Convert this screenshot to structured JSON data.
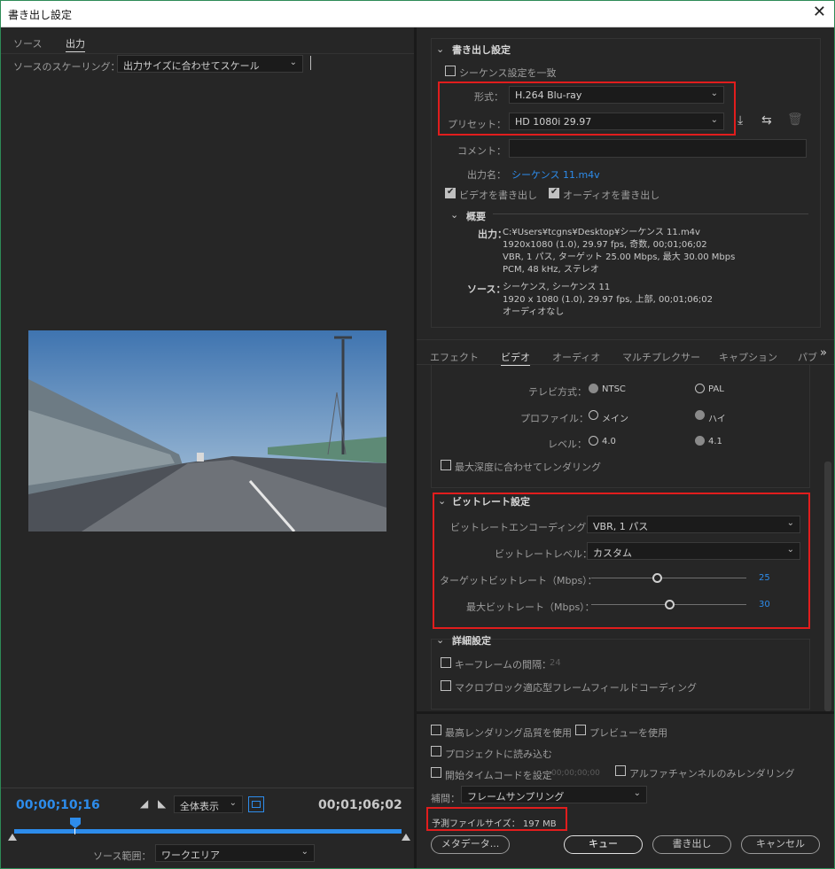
{
  "window": {
    "title": "書き出し設定",
    "close_icon": "close-icon"
  },
  "left": {
    "tabs": [
      "ソース",
      "出力"
    ],
    "scaling_label": "ソースのスケーリング：",
    "scaling_value": "出力サイズに合わせてスケール",
    "timecode_current": "00;00;10;16",
    "timecode_end": "00;01;06;02",
    "zoom_value": "全体表示",
    "source_range_label": "ソース範囲：",
    "source_range_value": "ワークエリア"
  },
  "export": {
    "header": "書き出し設定",
    "match_sequence": "シーケンス設定を一致",
    "format_label": "形式：",
    "format_value": "H.264 Blu-ray",
    "preset_label": "プリセット：",
    "preset_value": "HD 1080i 29.97",
    "comment_label": "コメント：",
    "output_name_label": "出力名：",
    "output_name_value": "シーケンス 11.m4v",
    "export_video": "ビデオを書き出し",
    "export_audio": "オーディオを書き出し",
    "summary_header": "概要",
    "summary_output_label": "出力：",
    "summary_output_lines": [
      "C:¥Users¥tcgns¥Desktop¥シーケンス 11.m4v",
      "1920x1080 (1.0), 29.97 fps, 奇数, 00;01;06;02",
      "VBR, 1 パス, ターゲット 25.00 Mbps, 最大 30.00 Mbps",
      "PCM, 48 kHz, ステレオ"
    ],
    "summary_source_label": "ソース：",
    "summary_source_lines": [
      "シーケンス, シーケンス 11",
      "1920 x 1080 (1.0), 29.97 fps, 上部, 00;01;06;02",
      "オーディオなし"
    ]
  },
  "tabs": [
    "エフェクト",
    "ビデオ",
    "オーディオ",
    "マルチプレクサー",
    "キャプション",
    "パブ"
  ],
  "video": {
    "tv_label": "テレビ方式：",
    "tv_opt1": "NTSC",
    "tv_opt2": "PAL",
    "profile_label": "プロファイル：",
    "profile_opt1": "メイン",
    "profile_opt2": "ハイ",
    "level_label": "レベル：",
    "level_opt1": "4.0",
    "level_opt2": "4.1",
    "max_depth": "最大深度に合わせてレンダリング",
    "bitrate_header": "ビットレート設定",
    "encoding_label": "ビットレートエンコーディング：",
    "encoding_value": "VBR, 1 パス",
    "level_bitrate_label": "ビットレートレベル：",
    "level_bitrate_value": "カスタム",
    "target_label": "ターゲットビットレート（Mbps）：",
    "target_value": "25",
    "target_fraction": 0.42,
    "max_label": "最大ビットレート（Mbps）：",
    "max_value": "30",
    "max_fraction": 0.5,
    "advanced_header": "詳細設定",
    "keyframe_label": "キーフレームの間隔：",
    "keyframe_value": "24",
    "macroblock": "マクロブロック適応型フレームフィールドコーディング"
  },
  "bottom": {
    "max_render": "最高レンダリング品質を使用",
    "use_preview": "プレビューを使用",
    "import_project": "プロジェクトに読み込む",
    "start_tc": "開始タイムコードを設定",
    "start_tc_value": "00;00;00;00",
    "alpha_only": "アルファチャンネルのみレンダリング",
    "interp_label": "補間：",
    "interp_value": "フレームサンプリング",
    "filesize": "予測ファイルサイズ： 197 MB",
    "btn_metadata": "メタデータ...",
    "btn_queue": "キュー",
    "btn_export": "書き出し",
    "btn_cancel": "キャンセル"
  }
}
